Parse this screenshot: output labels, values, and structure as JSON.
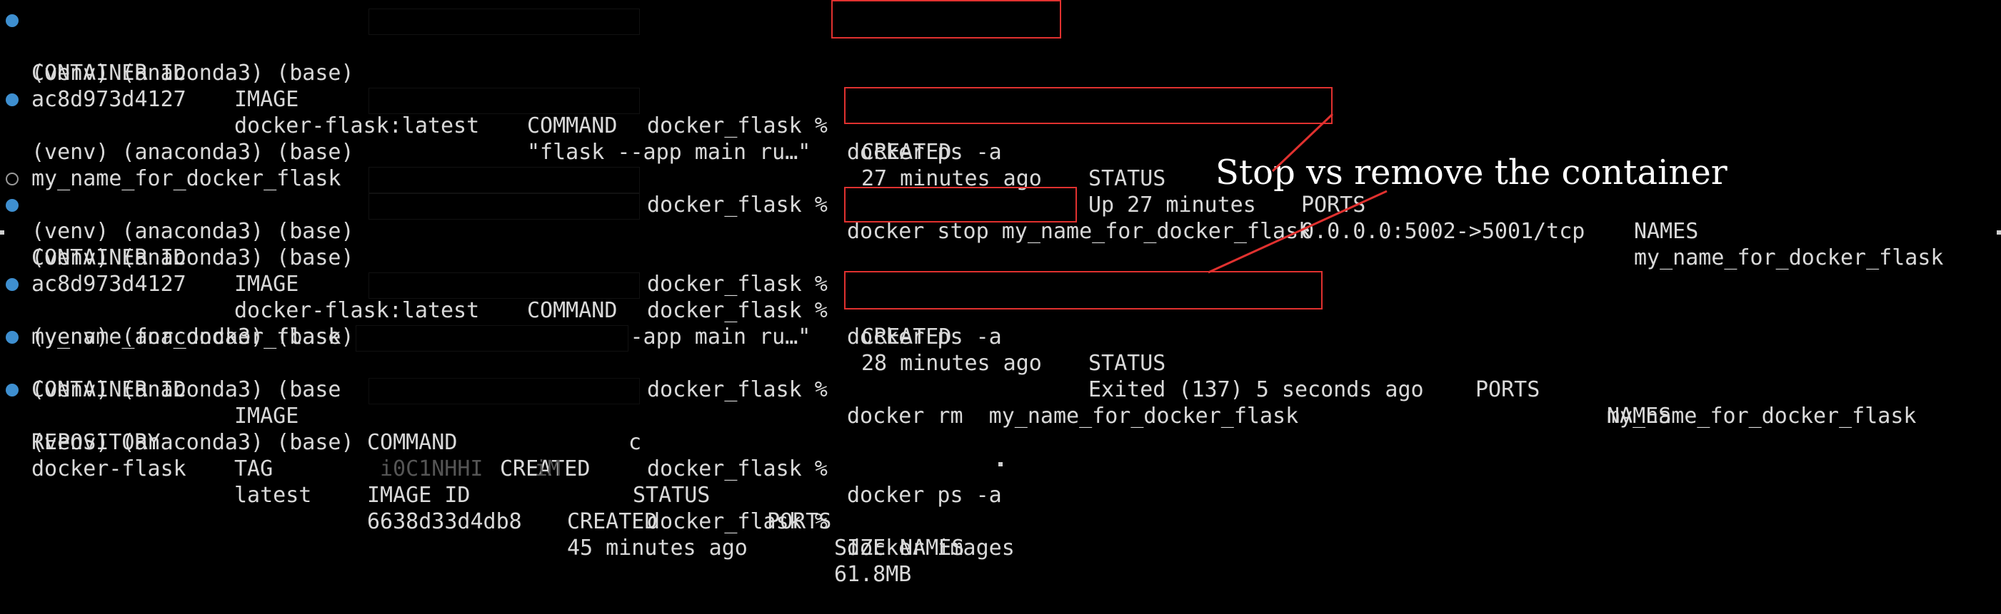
{
  "terminal": {
    "prompt_prefix": "(venv) (anaconda3) (base)",
    "prompt_prefix_cut": "(venv) (anaconda3) (base",
    "path": "docker_flask %",
    "redaction_leak_1": "c",
    "redaction_leak_2": "i0C1NHHI    iM",
    "lines": {
      "l1_cmd": "docker ps -a",
      "l2_headers": {
        "container_id": "CONTAINER ID",
        "image": "IMAGE",
        "command": "COMMAND",
        "created": "CREATED",
        "status": "STATUS",
        "ports": "PORTS",
        "names": "NAMES"
      },
      "l3_row": {
        "container_id": "ac8d973d4127",
        "image": "docker-flask:latest",
        "command": "\"flask --app main ru…\"",
        "created": "27 minutes ago",
        "status": "Up 27 minutes",
        "ports": "0.0.0.0:5002->5001/tcp",
        "names": "my_name_for_docker_flask"
      },
      "l4_cmd": "docker stop my_name_for_docker_flask",
      "l6_output": "my_name_for_docker_flask",
      "l9_cmd": "docker ps -a",
      "l10_headers": {
        "container_id": "CONTAINER ID",
        "image": "IMAGE",
        "command": "COMMAND",
        "created": "CREATED",
        "status": "STATUS",
        "ports": "PORTS",
        "names": "NAMES"
      },
      "l11_row": {
        "container_id": "ac8d973d4127",
        "image": "docker-flask:latest",
        "command": "\"flask --app main ru…\"",
        "created": "28 minutes ago",
        "status": "Exited (137) 5 seconds ago",
        "names": "my_name_for_docker_flask"
      },
      "l12_cmd": "docker rm  my_name_for_docker_flask",
      "l13_output": "my_name_for_docker_flask",
      "l14_cmd": "docker ps -a",
      "l15_headers": {
        "container_id": "CONTAINER ID",
        "image": "IMAGE",
        "command": "COMMAND",
        "created": "CREATED",
        "status": "STATUS",
        "ports": "PORTS",
        "names": "NAMES"
      },
      "l16_cmd": "docker images",
      "l17_headers": {
        "repository": "REPOSITORY",
        "tag": "TAG",
        "image_id": "IMAGE ID",
        "created": "CREATED",
        "size": "SIZE"
      },
      "l18_row": {
        "repository": "docker-flask",
        "tag": "latest",
        "image_id": "6638d33d4db8",
        "created": "45 minutes ago",
        "size": "61.8MB"
      }
    }
  },
  "annotation": {
    "text": "Stop vs remove the container"
  },
  "colors": {
    "background": "#000000",
    "text": "#d9d9d9",
    "prompt_dot": "#3e8fd0",
    "highlight_box": "#e0312f",
    "annotation_text": "#ffffff"
  }
}
